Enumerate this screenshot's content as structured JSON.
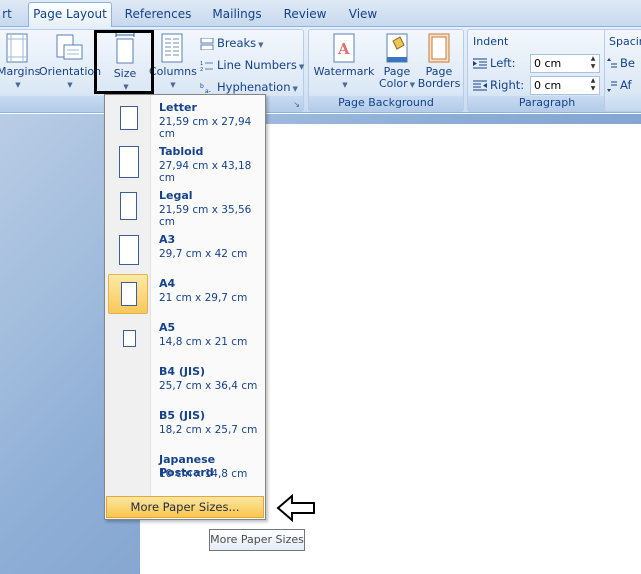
{
  "tabs": [
    {
      "label": "rt",
      "active": false
    },
    {
      "label": "Page Layout",
      "active": true
    },
    {
      "label": "References",
      "active": false
    },
    {
      "label": "Mailings",
      "active": false
    },
    {
      "label": "Review",
      "active": false
    },
    {
      "label": "View",
      "active": false
    }
  ],
  "page_setup": {
    "margins_label": "Margins",
    "orientation_label": "Orientation",
    "size_label": "Size",
    "columns_label": "Columns",
    "breaks_label": "Breaks",
    "line_numbers_label": "Line Numbers",
    "hyphenation_label": "Hyphenation"
  },
  "page_background": {
    "watermark_label": "Watermark",
    "page_color_label_1": "Page",
    "page_color_label_2": "Color",
    "page_borders_label_1": "Page",
    "page_borders_label_2": "Borders",
    "group_label": "Page Background"
  },
  "paragraph": {
    "indent_label": "Indent",
    "left_label": "Left:",
    "left_value": "0 cm",
    "right_label": "Right:",
    "right_value": "0 cm",
    "group_label": "Paragraph",
    "spacing_label": "Spacin",
    "before_label": "Be",
    "after_label": "Af"
  },
  "size_menu": {
    "items": [
      {
        "name": "Letter",
        "dims": "21,59 cm x 27,94 cm"
      },
      {
        "name": "Tabloid",
        "dims": "27,94 cm x 43,18 cm"
      },
      {
        "name": "Legal",
        "dims": "21,59 cm x 35,56 cm"
      },
      {
        "name": "A3",
        "dims": "29,7 cm x 42 cm"
      },
      {
        "name": "A4",
        "dims": "21 cm x 29,7 cm"
      },
      {
        "name": "A5",
        "dims": "14,8 cm x 21 cm"
      },
      {
        "name": "B4 (JIS)",
        "dims": "25,7 cm x 36,4 cm"
      },
      {
        "name": "B5 (JIS)",
        "dims": "18,2 cm x 25,7 cm"
      },
      {
        "name": "Japanese Postcard",
        "dims": "10 cm x 14,8 cm"
      }
    ],
    "selected": "A4",
    "more_label": "More Paper Sizes...",
    "tooltip": "More Paper Sizes"
  }
}
